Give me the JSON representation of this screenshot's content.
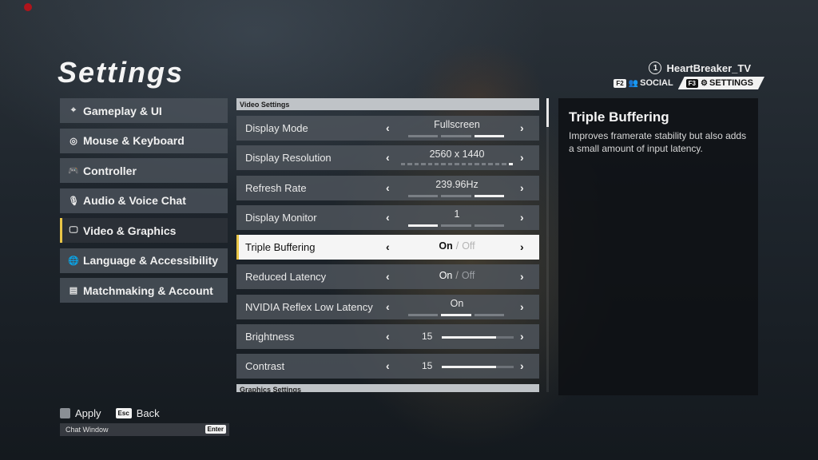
{
  "title": "Settings",
  "user": {
    "rank": "1",
    "name": "HeartBreaker_TV"
  },
  "topnav": {
    "social_key": "F2",
    "social_label": "SOCIAL",
    "settings_key": "F3",
    "settings_label": "SETTINGS"
  },
  "sidebar": {
    "items": [
      {
        "label": "Gameplay & UI",
        "icon": "crosshair-icon",
        "glyph": "⌖"
      },
      {
        "label": "Mouse & Keyboard",
        "icon": "mouse-icon",
        "glyph": "◎"
      },
      {
        "label": "Controller",
        "icon": "gamepad-icon",
        "glyph": "🎮"
      },
      {
        "label": "Audio & Voice Chat",
        "icon": "microphone-icon",
        "glyph": "🎙"
      },
      {
        "label": "Video & Graphics",
        "icon": "monitor-icon",
        "glyph": "🖵"
      },
      {
        "label": "Language & Accessibility",
        "icon": "globe-icon",
        "glyph": "🌐"
      },
      {
        "label": "Matchmaking & Account",
        "icon": "list-icon",
        "glyph": "▤"
      }
    ],
    "active_index": 4
  },
  "video": {
    "section_title": "Video Settings",
    "display_mode": {
      "label": "Display Mode",
      "value": "Fullscreen",
      "options": 3,
      "selected": 3
    },
    "resolution": {
      "label": "Display Resolution",
      "value": "2560 x 1440",
      "options": 17,
      "selected": 17
    },
    "refresh_rate": {
      "label": "Refresh Rate",
      "value": "239.96Hz",
      "options": 3,
      "selected": 3
    },
    "monitor": {
      "label": "Display Monitor",
      "value": "1",
      "options": 3,
      "selected": 1
    },
    "triple_buffering": {
      "label": "Triple Buffering",
      "on": "On",
      "sep": "/",
      "off": "Off"
    },
    "reduced_latency": {
      "label": "Reduced Latency",
      "on": "On",
      "sep": "/",
      "off": "Off"
    },
    "reflex": {
      "label": "NVIDIA Reflex Low Latency",
      "value": "On",
      "options": 3,
      "selected": 2
    },
    "brightness": {
      "label": "Brightness",
      "value": "15",
      "fraction": 0.75
    },
    "contrast": {
      "label": "Contrast",
      "value": "15",
      "fraction": 0.75
    }
  },
  "graphics": {
    "section_title": "Graphics Settings"
  },
  "info": {
    "title": "Triple Buffering",
    "description": "Improves framerate stability but also adds a small amount of input latency."
  },
  "footer": {
    "apply_label": "Apply",
    "esc_key": "Esc",
    "back_label": "Back",
    "chat_label": "Chat Window",
    "enter_key": "Enter"
  }
}
